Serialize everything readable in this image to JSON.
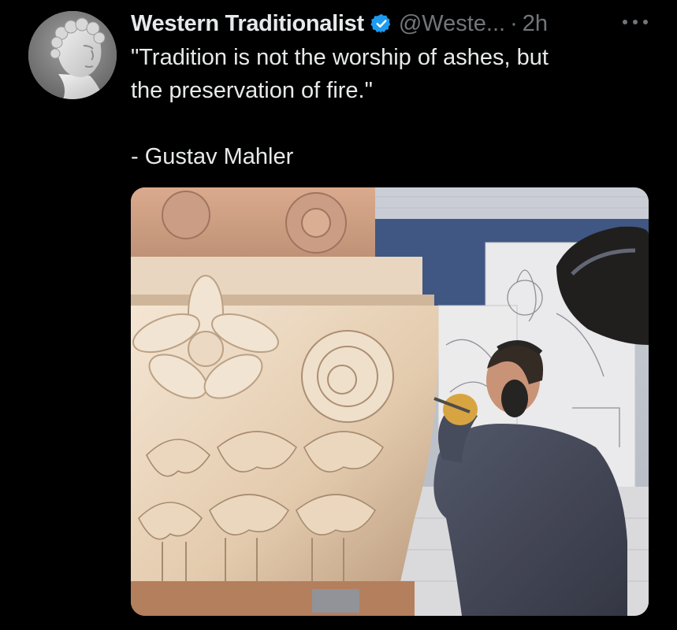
{
  "tweet": {
    "display_name": "Western Traditionalist",
    "handle": "@Weste...",
    "separator": "·",
    "time": "2h",
    "verified_icon": "verified-badge-icon",
    "more_icon": "more-options-icon",
    "text_lines": [
      "\"Tradition is not the worship of ashes, but",
      "the preservation of fire.\"",
      "- Gustav Mahler"
    ],
    "avatar_icon": "profile-avatar-statue",
    "media_icon": "stone-carver-photo"
  },
  "colors": {
    "background": "#000000",
    "primary_text": "#e7e9ea",
    "secondary_text": "#71767b",
    "verified": "#1d9bf0"
  }
}
